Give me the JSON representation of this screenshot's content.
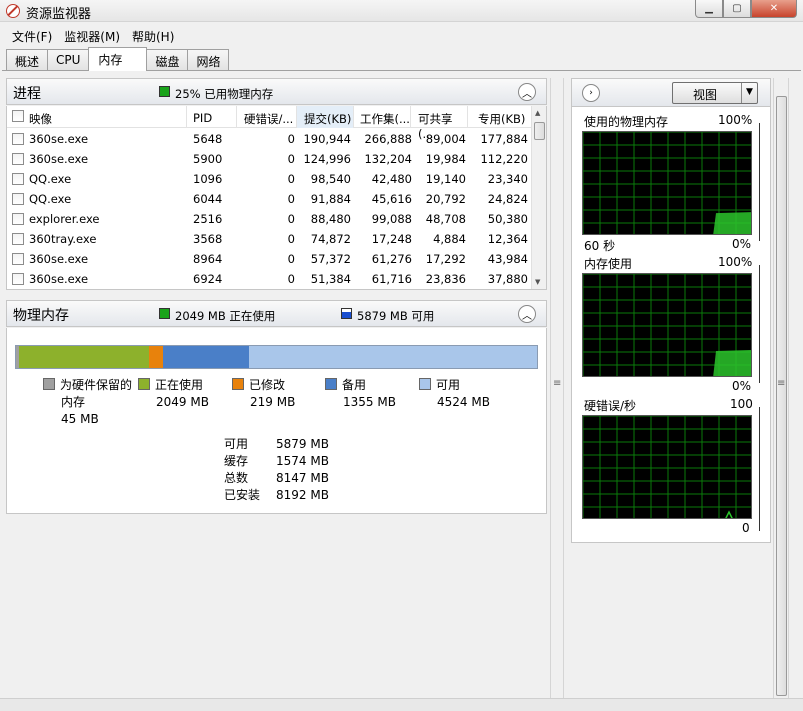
{
  "window": {
    "title": "资源监视器"
  },
  "menu": [
    "文件(F)",
    "监视器(M)",
    "帮助(H)"
  ],
  "tabs": [
    "概述",
    "CPU",
    "内存",
    "磁盘",
    "网络"
  ],
  "active_tab": "内存",
  "processes": {
    "title": "进程",
    "summary": "25% 已用物理内存",
    "columns": [
      "映像",
      "PID",
      "硬错误/...",
      "提交(KB)",
      "工作集(...",
      "可共享(...",
      "专用(KB)"
    ],
    "sorted_column": "提交(KB)",
    "rows": [
      [
        "360se.exe",
        "5648",
        "0",
        "190,944",
        "266,888",
        "89,004",
        "177,884"
      ],
      [
        "360se.exe",
        "5900",
        "0",
        "124,996",
        "132,204",
        "19,984",
        "112,220"
      ],
      [
        "QQ.exe",
        "1096",
        "0",
        "98,540",
        "42,480",
        "19,140",
        "23,340"
      ],
      [
        "QQ.exe",
        "6044",
        "0",
        "91,884",
        "45,616",
        "20,792",
        "24,824"
      ],
      [
        "explorer.exe",
        "2516",
        "0",
        "88,480",
        "99,088",
        "48,708",
        "50,380"
      ],
      [
        "360tray.exe",
        "3568",
        "0",
        "74,872",
        "17,248",
        "4,884",
        "12,364"
      ],
      [
        "360se.exe",
        "8964",
        "0",
        "57,372",
        "61,276",
        "17,292",
        "43,984"
      ],
      [
        "360se.exe",
        "6924",
        "0",
        "51,384",
        "61,716",
        "23,836",
        "37,880"
      ]
    ]
  },
  "physical_memory": {
    "title": "物理内存",
    "in_use_header": "2049 MB 正在使用",
    "available_header": "5879 MB 可用",
    "bar_segments_mb": [
      45,
      2049,
      219,
      1355,
      4524
    ],
    "legend": [
      {
        "label_line1": "为硬件保留的",
        "label_line2": "内存",
        "value": "45 MB",
        "color": "#a0a0a0"
      },
      {
        "label_line1": "正在使用",
        "value": "2049 MB",
        "color": "#8db12c"
      },
      {
        "label_line1": "已修改",
        "value": "219 MB",
        "color": "#e8820c"
      },
      {
        "label_line1": "备用",
        "value": "1355 MB",
        "color": "#4a7fc8"
      },
      {
        "label_line1": "可用",
        "value": "4524 MB",
        "color": "#a9c6ea"
      }
    ],
    "stats": [
      {
        "label": "可用",
        "value": "5879 MB"
      },
      {
        "label": "缓存",
        "value": "1574 MB"
      },
      {
        "label": "总数",
        "value": "8147 MB"
      },
      {
        "label": "已安装",
        "value": "8192 MB"
      }
    ]
  },
  "graphs_panel": {
    "view_button": "视图",
    "graphs": [
      {
        "title": "使用的物理内存",
        "max": "100%",
        "time": "60 秒",
        "min": "0%",
        "level": 0.22
      },
      {
        "title": "内存使用",
        "max": "100%",
        "min": "0%",
        "level": 0.26
      },
      {
        "title": "硬错误/秒",
        "max": "100",
        "min": "0",
        "level": 0.0
      }
    ]
  },
  "colors": {
    "green_legend": "#1aa31a",
    "blue_legend": "#1a4fd0",
    "graph_grid": "#0a7a0a",
    "graph_fill": "#2bc42b"
  }
}
